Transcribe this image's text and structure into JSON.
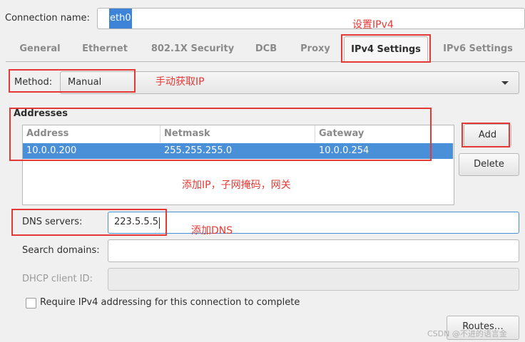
{
  "connection": {
    "label": "Connection name:",
    "value": "eth0"
  },
  "tabs": [
    {
      "label": "General"
    },
    {
      "label": "Ethernet"
    },
    {
      "label": "802.1X Security"
    },
    {
      "label": "DCB"
    },
    {
      "label": "Proxy"
    },
    {
      "label": "IPv4 Settings"
    },
    {
      "label": "IPv6 Settings"
    }
  ],
  "active_tab": "IPv4 Settings",
  "method": {
    "label": "Method:",
    "value": "Manual"
  },
  "addresses": {
    "title": "Addresses",
    "columns": [
      "Address",
      "Netmask",
      "Gateway"
    ],
    "rows": [
      {
        "address": "10.0.0.200",
        "netmask": "255.255.255.0",
        "gateway": "10.0.0.254"
      }
    ],
    "add_label": "Add",
    "delete_label": "Delete"
  },
  "dns": {
    "label": "DNS servers:",
    "value": "223.5.5.5"
  },
  "search": {
    "label": "Search domains:",
    "value": ""
  },
  "dhcp": {
    "label": "DHCP client ID:",
    "value": ""
  },
  "require": {
    "label": "Require IPv4 addressing for this connection to complete",
    "checked": false
  },
  "routes_label": "Routes…",
  "annotations": {
    "set_ipv4": "设置IPv4",
    "manual_ip": "手动获取IP",
    "add_ip": "添加IP，子网掩码，网关",
    "add_dns": "添加DNS"
  },
  "watermark": "CSDN @不进的语言金",
  "colors": {
    "selection": "#4a90d9",
    "annotation": "#e53935",
    "focus": "#4a90d9"
  }
}
